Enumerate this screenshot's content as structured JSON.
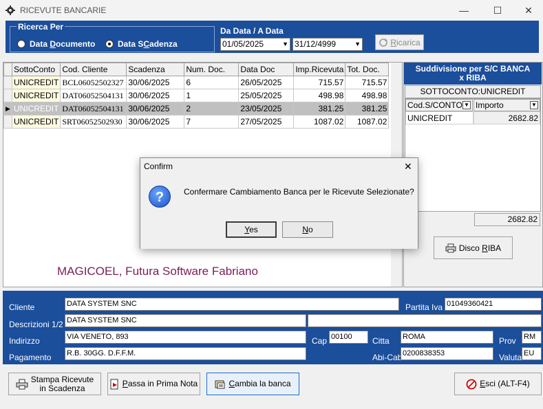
{
  "window": {
    "title": "RICEVUTE BANCARIE"
  },
  "ricerca": {
    "label": "Ricerca Per",
    "options": [
      {
        "pre": "Data ",
        "ul": "D",
        "post": "ocumento",
        "selected": false
      },
      {
        "pre": "Data S",
        "ul": "C",
        "post": "adenza",
        "selected": true
      }
    ]
  },
  "date_range": {
    "label": "Da Data / A Data",
    "from": "01/05/2025",
    "to": "31/12/4999"
  },
  "toolbar": {
    "ricarica_ul": "R",
    "ricarica_rest": "icarica"
  },
  "grid": {
    "columns": [
      "SottoConto",
      "Cod. Cliente",
      "Scadenza",
      "Num. Doc.",
      "Data Doc",
      "Imp.Ricevuta",
      "Tot. Doc."
    ],
    "rows": [
      [
        "UNICREDIT",
        "BCL06052502327",
        "30/06/2025",
        "6",
        "26/05/2025",
        "715.57",
        "715.57"
      ],
      [
        "UNICREDIT",
        "DAT06052504131",
        "30/06/2025",
        "1",
        "25/05/2025",
        "498.98",
        "498.98"
      ],
      [
        "UNICREDIT",
        "DAT06052504131",
        "30/06/2025",
        "2",
        "23/05/2025",
        "381.25",
        "381.25"
      ],
      [
        "UNICREDIT",
        "SRT06052502930",
        "30/06/2025",
        "7",
        "27/05/2025",
        "1087.02",
        "1087.02"
      ]
    ],
    "selected_row": 2
  },
  "branding": "MAGICOEL, Futura Software Fabriano",
  "suddivisione": {
    "title_line1": "Suddivisione per S/C BANCA",
    "title_line2": "x RIBA",
    "subheader": "SOTTOCONTO:UNICREDIT",
    "col_cod": "Cod.S/CONTO",
    "col_importo": "Importo",
    "row_cod": "UNICREDIT",
    "row_importo": "2682.82",
    "total": "2682.82",
    "disco_pre": "Disco ",
    "disco_ul": "R",
    "disco_post": "IBA"
  },
  "cliente": {
    "label_cliente": "Cliente",
    "cliente": "DATA SYSTEM SNC",
    "label_piva": "Partita Iva",
    "piva": "01049360421",
    "label_descr": "Descrizioni 1/2",
    "descr1": "DATA SYSTEM SNC",
    "descr2": "",
    "label_indirizzo": "Indirizzo",
    "indirizzo": "VIA VENETO, 893",
    "label_cap": "Cap",
    "cap": "00100",
    "label_citta": "Citta",
    "citta": "ROMA",
    "label_prov": "Prov",
    "prov": "RM",
    "label_pagamento": "Pagamento",
    "pagamento": "R.B. 30GG. D.F.F.M.",
    "label_abicab": "Abi-Cab",
    "abicab": "0200838353",
    "label_valuta": "Valuta",
    "valuta": "EU"
  },
  "buttons": {
    "stampa_line1": "Stampa Ricevute",
    "stampa_line2": "in Scadenza",
    "passa_ul": "P",
    "passa_rest": "assa in Prima Nota",
    "cambia_ul": "C",
    "cambia_rest": "ambia la banca",
    "esci_ul": "E",
    "esci_rest": "sci (ALT-F4)"
  },
  "dialog": {
    "title": "Confirm",
    "message": "Confermare Cambiamento Banca per le Ricevute Selezionate?",
    "yes_ul": "Y",
    "yes_rest": "es",
    "no_ul": "N",
    "no_rest": "o"
  }
}
